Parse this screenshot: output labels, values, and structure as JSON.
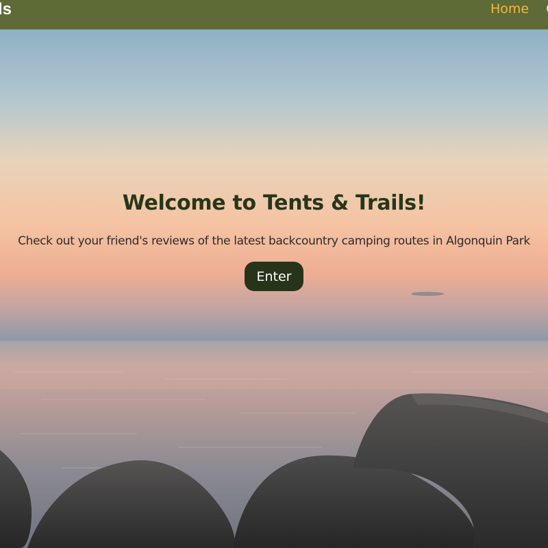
{
  "navbar": {
    "brand": "Tents & Trails",
    "links": [
      {
        "label": "Home",
        "active": true
      },
      {
        "label": "C",
        "active": false
      }
    ]
  },
  "hero": {
    "title": "Welcome to Tents & Trails!",
    "subtitle": "Check out your friend's reviews of the latest backcountry camping routes in Algonquin Park",
    "button_label": "Enter",
    "background": "sunset-over-lake-with-rocks-photo"
  },
  "colors": {
    "navbar": "#5f6b36",
    "active_link": "#f2b840",
    "title": "#27361a",
    "button": "#28341a"
  }
}
